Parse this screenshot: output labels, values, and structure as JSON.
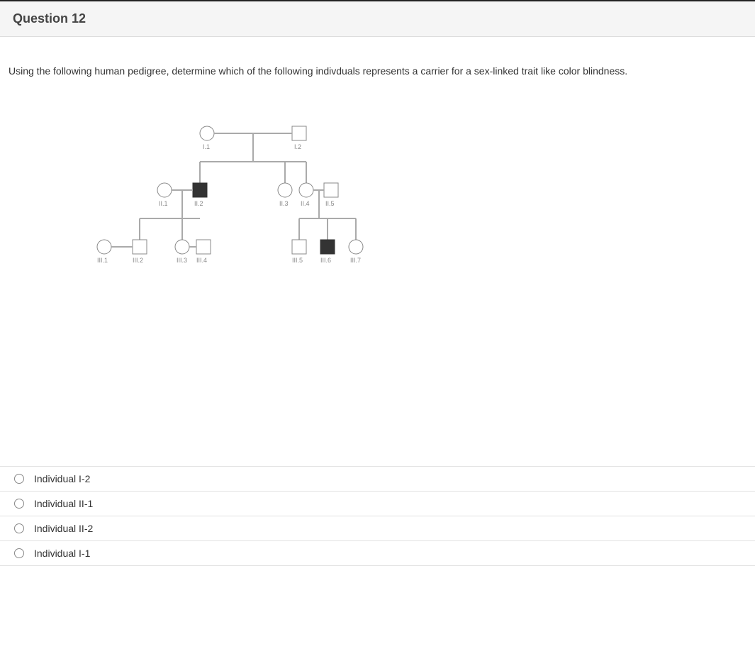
{
  "question": {
    "number_label": "Question 12",
    "prompt": "Using the following human pedigree, determine which of the following indivduals represents a carrier for a sex-linked trait like color blindness."
  },
  "pedigree": {
    "generations": [
      {
        "gen": "I",
        "members": [
          {
            "id": "I.1",
            "sex": "F",
            "affected": false
          },
          {
            "id": "I.2",
            "sex": "M",
            "affected": false
          }
        ],
        "matings": [
          [
            "I.1",
            "I.2"
          ]
        ]
      },
      {
        "gen": "II",
        "members": [
          {
            "id": "II.1",
            "sex": "F",
            "affected": false,
            "marry_in": true
          },
          {
            "id": "II.2",
            "sex": "M",
            "affected": true
          },
          {
            "id": "II.3",
            "sex": "F",
            "affected": false
          },
          {
            "id": "II.4",
            "sex": "F",
            "affected": false
          },
          {
            "id": "II.5",
            "sex": "M",
            "affected": false,
            "marry_in": true
          }
        ],
        "matings": [
          [
            "II.1",
            "II.2"
          ],
          [
            "II.4",
            "II.5"
          ]
        ]
      },
      {
        "gen": "III",
        "members": [
          {
            "id": "III.1",
            "sex": "F",
            "affected": false,
            "marry_in": true
          },
          {
            "id": "III.2",
            "sex": "M",
            "affected": false
          },
          {
            "id": "III.3",
            "sex": "F",
            "affected": false
          },
          {
            "id": "III.4",
            "sex": "M",
            "affected": false
          },
          {
            "id": "III.5",
            "sex": "M",
            "affected": false
          },
          {
            "id": "III.6",
            "sex": "M",
            "affected": true
          },
          {
            "id": "III.7",
            "sex": "F",
            "affected": false
          }
        ],
        "matings": [
          [
            "III.1",
            "III.2"
          ],
          [
            "III.3",
            "III.4"
          ]
        ]
      }
    ]
  },
  "answers": {
    "options": [
      {
        "label": "Individual I-2"
      },
      {
        "label": "Individual II-1"
      },
      {
        "label": "Individual II-2"
      },
      {
        "label": "Individual I-1"
      }
    ]
  },
  "labels": {
    "I1": "I.1",
    "I2": "I.2",
    "II1": "II.1",
    "II2": "II.2",
    "II3": "II.3",
    "II4": "II.4",
    "II5": "II.5",
    "III1": "III.1",
    "III2": "III.2",
    "III3": "III.3",
    "III4": "III.4",
    "III5": "III.5",
    "III6": "III.6",
    "III7": "III.7"
  }
}
